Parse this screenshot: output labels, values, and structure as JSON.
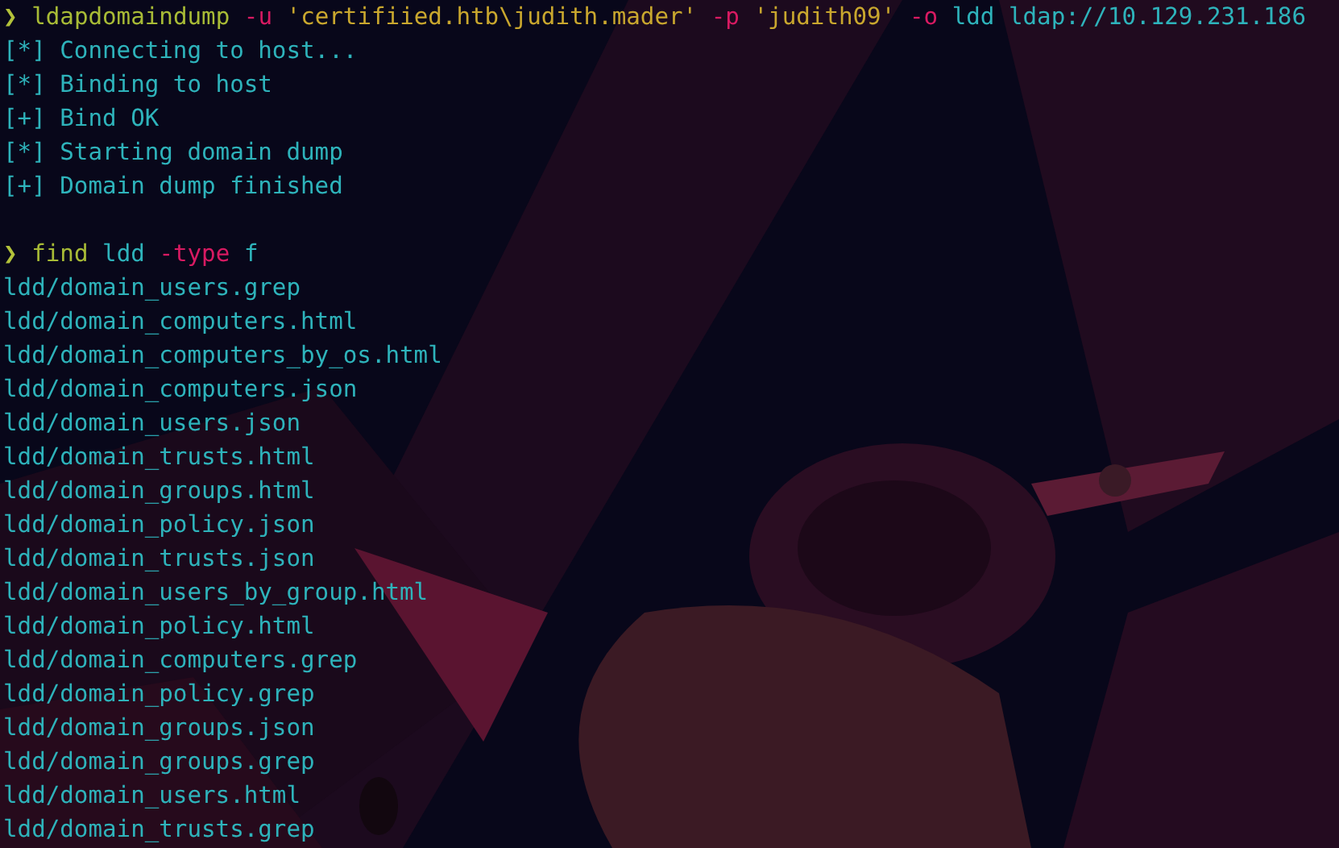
{
  "terminal": {
    "lines": [
      {
        "kind": "command",
        "segments": [
          {
            "kind": "prompt",
            "text": "❯"
          },
          {
            "kind": "program",
            "text": "ldapdomaindump"
          },
          {
            "kind": "flag",
            "text": "-u"
          },
          {
            "kind": "string",
            "text": "'certifiied.htb\\judith.mader'"
          },
          {
            "kind": "flag",
            "text": "-p"
          },
          {
            "kind": "string",
            "text": "'judith09'"
          },
          {
            "kind": "flag",
            "text": "-o"
          },
          {
            "kind": "arg",
            "text": "ldd"
          },
          {
            "kind": "arg",
            "text": "ldap://10.129.231.186"
          }
        ]
      },
      {
        "kind": "output",
        "text": "[*] Connecting to host..."
      },
      {
        "kind": "output",
        "text": "[*] Binding to host"
      },
      {
        "kind": "output",
        "text": "[+] Bind OK"
      },
      {
        "kind": "output",
        "text": "[*] Starting domain dump"
      },
      {
        "kind": "output",
        "text": "[+] Domain dump finished"
      },
      {
        "kind": "blank"
      },
      {
        "kind": "command",
        "segments": [
          {
            "kind": "prompt",
            "text": "❯"
          },
          {
            "kind": "program",
            "text": "find"
          },
          {
            "kind": "arg",
            "text": "ldd"
          },
          {
            "kind": "flag",
            "text": "-type"
          },
          {
            "kind": "arg",
            "text": "f"
          }
        ]
      },
      {
        "kind": "output",
        "text": "ldd/domain_users.grep"
      },
      {
        "kind": "output",
        "text": "ldd/domain_computers.html"
      },
      {
        "kind": "output",
        "text": "ldd/domain_computers_by_os.html"
      },
      {
        "kind": "output",
        "text": "ldd/domain_computers.json"
      },
      {
        "kind": "output",
        "text": "ldd/domain_users.json"
      },
      {
        "kind": "output",
        "text": "ldd/domain_trusts.html"
      },
      {
        "kind": "output",
        "text": "ldd/domain_groups.html"
      },
      {
        "kind": "output",
        "text": "ldd/domain_policy.json"
      },
      {
        "kind": "output",
        "text": "ldd/domain_trusts.json"
      },
      {
        "kind": "output",
        "text": "ldd/domain_users_by_group.html"
      },
      {
        "kind": "output",
        "text": "ldd/domain_policy.html"
      },
      {
        "kind": "output",
        "text": "ldd/domain_computers.grep"
      },
      {
        "kind": "output",
        "text": "ldd/domain_policy.grep"
      },
      {
        "kind": "output",
        "text": "ldd/domain_groups.json"
      },
      {
        "kind": "output",
        "text": "ldd/domain_groups.grep"
      },
      {
        "kind": "output",
        "text": "ldd/domain_users.html"
      },
      {
        "kind": "output",
        "text": "ldd/domain_trusts.grep"
      }
    ]
  }
}
